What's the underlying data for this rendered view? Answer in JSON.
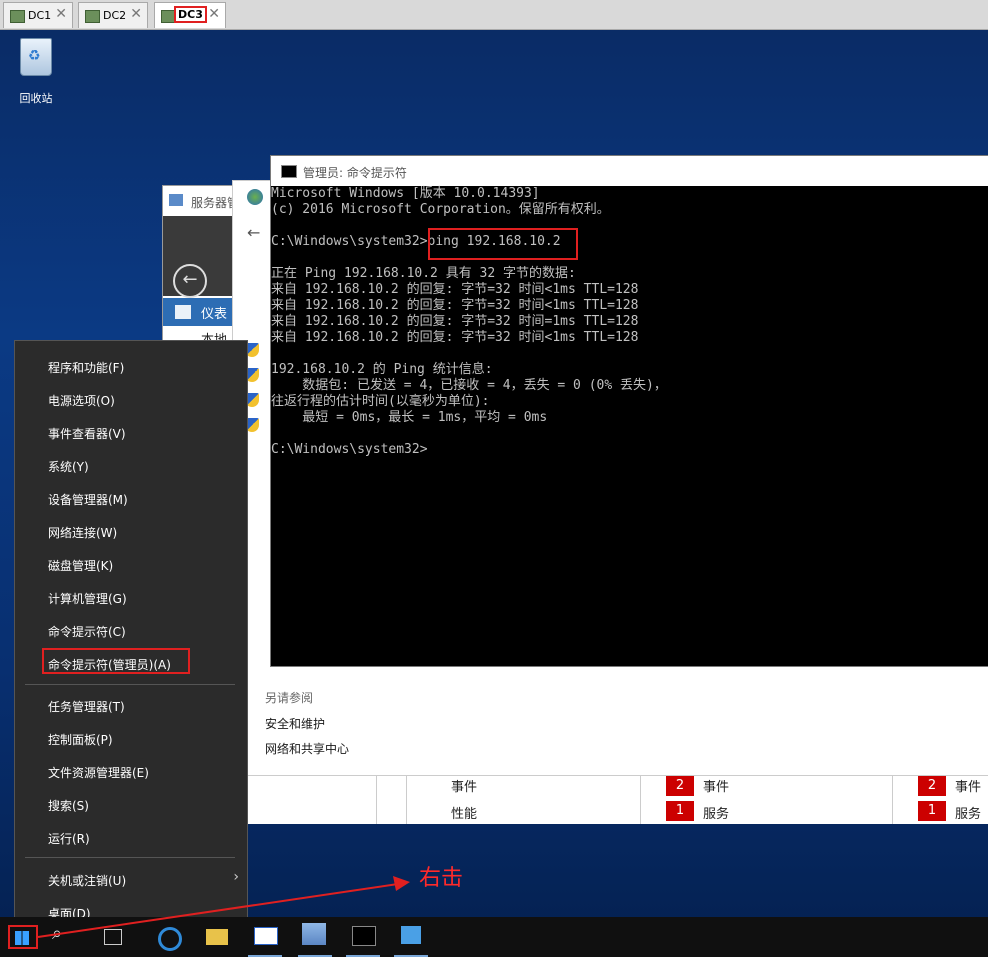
{
  "tabs": [
    {
      "label": "DC1"
    },
    {
      "label": "DC2"
    },
    {
      "label": "DC3"
    }
  ],
  "desktop": {
    "recycle_bin": "回收站"
  },
  "server_manager": {
    "title": "服务器管",
    "nav_selected": "仪表",
    "nav_next": "本地"
  },
  "control_panel": {
    "see_also": "另请参阅",
    "links": [
      "安全和维护",
      "网络和共享中心"
    ]
  },
  "dashboard_grid": {
    "left_labels": [
      "事件",
      "性能"
    ],
    "cols": [
      {
        "rows": [
          {
            "count": "2",
            "label": "事件"
          },
          {
            "count": "1",
            "label": "服务"
          }
        ]
      },
      {
        "rows": [
          {
            "count": "2",
            "label": "事件"
          },
          {
            "count": "1",
            "label": "服务"
          }
        ]
      }
    ]
  },
  "cmd": {
    "title": "管理员: 命令提示符",
    "lines": [
      "Microsoft Windows [版本 10.0.14393]",
      "(c) 2016 Microsoft Corporation。保留所有权利。",
      "",
      "C:\\Windows\\system32>ping 192.168.10.2",
      "",
      "正在 Ping 192.168.10.2 具有 32 字节的数据:",
      "来自 192.168.10.2 的回复: 字节=32 时间<1ms TTL=128",
      "来自 192.168.10.2 的回复: 字节=32 时间<1ms TTL=128",
      "来自 192.168.10.2 的回复: 字节=32 时间=1ms TTL=128",
      "来自 192.168.10.2 的回复: 字节=32 时间<1ms TTL=128",
      "",
      "192.168.10.2 的 Ping 统计信息:",
      "    数据包: 已发送 = 4，已接收 = 4，丢失 = 0 (0% 丢失)，",
      "往返行程的估计时间(以毫秒为单位):",
      "    最短 = 0ms，最长 = 1ms，平均 = 0ms",
      "",
      "C:\\Windows\\system32>"
    ]
  },
  "winx_menu": {
    "items": [
      "程序和功能(F)",
      "电源选项(O)",
      "事件查看器(V)",
      "系统(Y)",
      "设备管理器(M)",
      "网络连接(W)",
      "磁盘管理(K)",
      "计算机管理(G)",
      "命令提示符(C)",
      "命令提示符(管理员)(A)",
      "任务管理器(T)",
      "控制面板(P)",
      "文件资源管理器(E)",
      "搜索(S)",
      "运行(R)",
      "关机或注销(U)",
      "桌面(D)"
    ]
  },
  "annotation": {
    "text": "右击"
  }
}
